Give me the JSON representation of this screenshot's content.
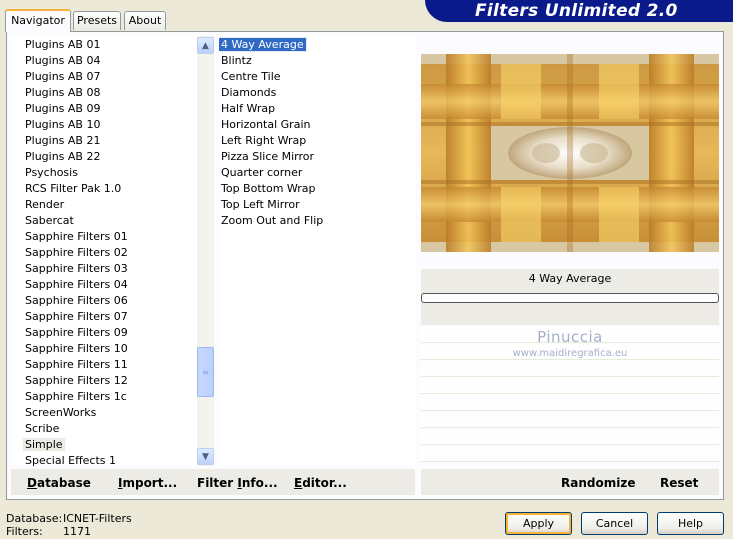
{
  "app": {
    "banner_title": "Filters Unlimited 2.0"
  },
  "tabs": [
    {
      "label": "Navigator",
      "active": true
    },
    {
      "label": "Presets",
      "active": false
    },
    {
      "label": "About",
      "active": false
    }
  ],
  "categories": [
    "Plugins AB 01",
    "Plugins AB 04",
    "Plugins AB 07",
    "Plugins AB 08",
    "Plugins AB 09",
    "Plugins AB 10",
    "Plugins AB 21",
    "Plugins AB 22",
    "Psychosis",
    "RCS Filter Pak 1.0",
    "Render",
    "Sabercat",
    "Sapphire Filters 01",
    "Sapphire Filters 02",
    "Sapphire Filters 03",
    "Sapphire Filters 04",
    "Sapphire Filters 06",
    "Sapphire Filters 07",
    "Sapphire Filters 09",
    "Sapphire Filters 10",
    "Sapphire Filters 11",
    "Sapphire Filters 12",
    "Sapphire Filters 1c",
    "ScreenWorks",
    "Scribe",
    "Simple",
    "Special Effects 1"
  ],
  "selected_category": "Simple",
  "filters": [
    "4 Way Average",
    "Blintz",
    "Centre Tile",
    "Diamonds",
    "Half Wrap",
    "Horizontal Grain",
    "Left Right Wrap",
    "Pizza Slice Mirror",
    "Quarter corner",
    "Top Bottom Wrap",
    "Top Left Mirror",
    "Zoom Out and Flip"
  ],
  "selected_filter": "4 Way Average",
  "preview": {
    "filter_name": "4 Way Average",
    "progress": 0
  },
  "watermark": {
    "name": "Pinuccia",
    "url": "www.maidiregrafica.eu"
  },
  "toolbar": {
    "database": {
      "u": "D",
      "rest": "atabase"
    },
    "import": {
      "u": "I",
      "rest": "mport..."
    },
    "filter_info": {
      "pre": "Filter ",
      "u": "I",
      "rest": "nfo..."
    },
    "editor": {
      "u": "E",
      "rest": "ditor..."
    },
    "randomize": "Randomize",
    "reset": "Reset"
  },
  "status": {
    "database_label": "Database:",
    "database_value": "ICNET-Filters",
    "filters_label": "Filters:",
    "filters_value": "1171"
  },
  "buttons": {
    "apply": "Apply",
    "cancel": "Cancel",
    "help": "Help"
  }
}
